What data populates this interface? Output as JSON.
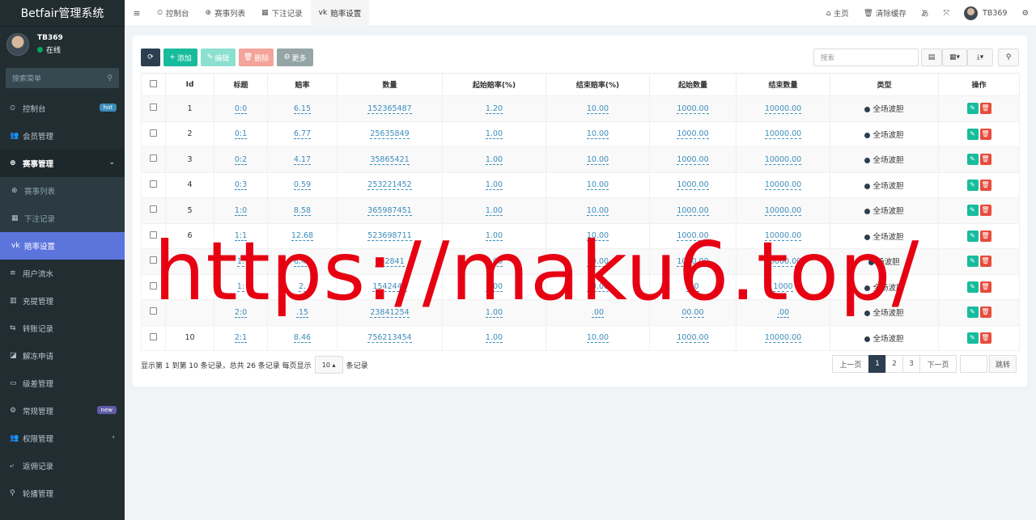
{
  "app_title": "Betfair管理系统",
  "user": {
    "name": "TB369",
    "status": "在线"
  },
  "sidebar_search_placeholder": "搜索菜单",
  "menu": [
    {
      "icon": "dashboard-icon",
      "glyph": "⏲",
      "label": "控制台",
      "badge": "hot"
    },
    {
      "icon": "users-icon",
      "glyph": "👥",
      "label": "会员管理"
    },
    {
      "icon": "globe-icon",
      "glyph": "⊕",
      "label": "赛事管理",
      "open": true
    },
    {
      "icon": "globe-icon",
      "glyph": "⊕",
      "label": "赛事列表",
      "sub": true
    },
    {
      "icon": "calendar-icon",
      "glyph": "▦",
      "label": "下注记录",
      "sub": true
    },
    {
      "icon": "vk-icon",
      "glyph": "vk",
      "label": "赔率设置",
      "sub": true,
      "active": true
    },
    {
      "icon": "list-icon",
      "glyph": "≡",
      "label": "用户流水"
    },
    {
      "icon": "barcode-icon",
      "glyph": "▥",
      "label": "充提管理"
    },
    {
      "icon": "transfer-icon",
      "glyph": "⇆",
      "label": "转账记录"
    },
    {
      "icon": "unlock-icon",
      "glyph": "◪",
      "label": "解冻申请"
    },
    {
      "icon": "window-icon",
      "glyph": "▭",
      "label": "级差管理"
    },
    {
      "icon": "gears-icon",
      "glyph": "⚙",
      "label": "常规管理",
      "badge": "new"
    },
    {
      "icon": "users-icon",
      "glyph": "👥",
      "label": "权限管理",
      "caret": "‹"
    },
    {
      "icon": "return-icon",
      "glyph": "⤶",
      "label": "返佣记录"
    },
    {
      "icon": "carousel-icon",
      "glyph": "⚲",
      "label": "轮播管理"
    }
  ],
  "topbar": {
    "tabs": [
      {
        "icon": "dashboard-icon",
        "glyph": "⏲",
        "label": "控制台"
      },
      {
        "icon": "globe-icon",
        "glyph": "⊕",
        "label": "赛事列表"
      },
      {
        "icon": "calendar-icon",
        "glyph": "▦",
        "label": "下注记录"
      },
      {
        "icon": "vk-icon",
        "glyph": "vk",
        "label": "赔率设置",
        "active": true
      }
    ],
    "home": "主页",
    "clear_cache": "清除缓存",
    "username": "TB369"
  },
  "toolbar": {
    "add": "添加",
    "edit": "编辑",
    "delete": "删除",
    "more": "更多",
    "search_placeholder": "搜索"
  },
  "table": {
    "columns": [
      "Id",
      "标题",
      "赔率",
      "数量",
      "起始赔率(%)",
      "结束赔率(%)",
      "起始数量",
      "结束数量",
      "类型",
      "操作"
    ],
    "rows": [
      {
        "id": "1",
        "title": "0:0",
        "odds": "6.15",
        "qty": "152365487",
        "start_rate": "1.20",
        "end_rate": "10.00",
        "start_qty": "1000.00",
        "end_qty": "10000.00",
        "type": "全场波胆"
      },
      {
        "id": "2",
        "title": "0:1",
        "odds": "6.77",
        "qty": "25635849",
        "start_rate": "1.00",
        "end_rate": "10.00",
        "start_qty": "1000.00",
        "end_qty": "10000.00",
        "type": "全场波胆"
      },
      {
        "id": "3",
        "title": "0:2",
        "odds": "4.17",
        "qty": "35865421",
        "start_rate": "1.00",
        "end_rate": "10.00",
        "start_qty": "1000.00",
        "end_qty": "10000.00",
        "type": "全场波胆"
      },
      {
        "id": "4",
        "title": "0:3",
        "odds": "0.59",
        "qty": "253221452",
        "start_rate": "1.00",
        "end_rate": "10.00",
        "start_qty": "1000.00",
        "end_qty": "10000.00",
        "type": "全场波胆"
      },
      {
        "id": "5",
        "title": "1:0",
        "odds": "8.58",
        "qty": "365987451",
        "start_rate": "1.00",
        "end_rate": "10.00",
        "start_qty": "1000.00",
        "end_qty": "10000.00",
        "type": "全场波胆"
      },
      {
        "id": "6",
        "title": "1:1",
        "odds": "12.68",
        "qty": "523698711",
        "start_rate": "1.00",
        "end_rate": "10.00",
        "start_qty": "1000.00",
        "end_qty": "10000.00",
        "type": "全场波胆"
      },
      {
        "id": "7",
        "title": "1:",
        "odds": "6.47",
        "qty": "652841",
        "start_rate": "1.00",
        "end_rate": "10.00",
        "start_qty": "1000.00",
        "end_qty": "10000.00",
        "type": "场波胆"
      },
      {
        "id": "",
        "title": "1:",
        "odds": "2.",
        "qty": "1542445",
        "start_rate": "1.00",
        "end_rate": "10.00",
        "start_qty": ".00",
        "end_qty": "1000",
        "type": "全场波胆"
      },
      {
        "id": "",
        "title": "2:0",
        "odds": ".15",
        "qty": "23841254",
        "start_rate": "1.00",
        "end_rate": ".00",
        "start_qty": "00.00",
        "end_qty": ".00",
        "type": "全场波胆"
      },
      {
        "id": "10",
        "title": "2:1",
        "odds": "8.46",
        "qty": "756213454",
        "start_rate": "1.00",
        "end_rate": "10.00",
        "start_qty": "1000.00",
        "end_qty": "10000.00",
        "type": "全场波胆"
      }
    ]
  },
  "pager": {
    "info_prefix": "显示第 1 到第 10 条记录，总共 26 条记录 每页显示",
    "page_size": "10",
    "info_suffix": "条记录",
    "prev": "上一页",
    "pages": [
      "1",
      "2",
      "3"
    ],
    "next": "下一页",
    "jump": "跳转"
  },
  "watermark": "https://maku6.top/",
  "colors": {
    "sidebar_bg": "#222d32",
    "active_menu": "#5b75dd",
    "add": "#18bc9c",
    "delete": "#e74c3c",
    "link": "#3c8dbc",
    "watermark": "#e60012"
  }
}
